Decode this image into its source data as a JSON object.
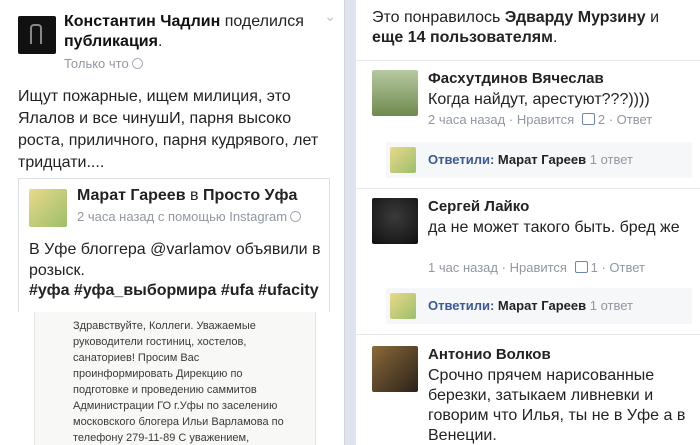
{
  "left": {
    "author": "Константин Чадлин",
    "action": "поделился",
    "object": "публикация",
    "period": ".",
    "time": "Только что",
    "text": "Ищут пожарные, ищем милиция, это Ялалов и все чинушИ, парня высоко роста, приличного, парня кудрявого, лет тридцати....",
    "shared": {
      "author": "Марат Гареев",
      "in_word": "в",
      "group": "Просто Уфа",
      "meta": "2 часа назад с помощью Instagram",
      "text": "В Уфе блоггера @varlamov объявили в розыск.",
      "tags": "#уфа #уфа_выбормира #ufa #ufacity"
    },
    "document": {
      "lines": [
        "Здравствуйте, Коллеги. Уважаемые",
        "руководители гостиниц, хостелов,",
        "санаториев! Просим Вас",
        "проинформировать Дирекцию по",
        "подготовке и проведению саммитов",
        "Администрации ГО г.Уфы по заселению",
        "московского блогера Ильи Варламова по",
        "телефону 279-11-89 С уважением,"
      ]
    }
  },
  "right": {
    "likes_prefix": "Это понравилось",
    "likes_name": "Эдварду Мурзину",
    "likes_and": "и",
    "likes_others": "еще 14 пользователям",
    "likes_period": ".",
    "comments": [
      {
        "name": "Фасхутдинов Вячеслав",
        "text": "Когда найдут, арестуют???))))",
        "time": "2 часа назад",
        "sep": "·",
        "like_label": "Нравится",
        "likes": "2",
        "reply_label": "Ответ",
        "reply": {
          "label": "Ответили:",
          "name": "Марат Гареев",
          "count": "1 ответ"
        }
      },
      {
        "name": "Сергей Лайко",
        "text": "да не может такого быть. бред же",
        "time": "1 час назад",
        "sep": "·",
        "like_label": "Нравится",
        "likes": "1",
        "reply_label": "Ответ",
        "reply": {
          "label": "Ответили:",
          "name": "Марат Гареев",
          "count": "1 ответ"
        }
      },
      {
        "name": "Антонио Волков",
        "text": "Срочно прячем нарисованные березки, затыкаем ливневки и говорим что Илья, ты не в Уфе а в Венеции."
      }
    ]
  },
  "colors": {
    "link": "#3b5998",
    "meta": "#9197a3",
    "background": "#dfe3ee"
  },
  "icons": [
    "globe-icon",
    "chevron-down-icon",
    "thumbs-up-icon"
  ]
}
